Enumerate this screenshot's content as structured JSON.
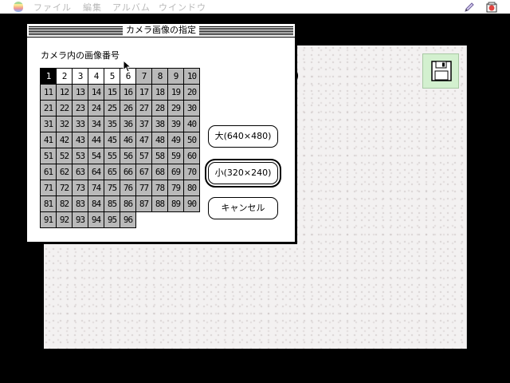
{
  "menubar": {
    "items": [
      "ファイル",
      "編集",
      "アルバム",
      "ウインドウ"
    ],
    "right_icons": [
      "pencil-icon",
      "application-icon"
    ]
  },
  "document_window": {
    "toolbar_icon": "floppy-disk-icon"
  },
  "dialog": {
    "title": "カメラ画像の指定",
    "grid_label": "カメラ内の画像番号",
    "selected_photo": 1,
    "photo_count": 96,
    "unshaded_numbers": [
      2,
      3,
      4,
      5,
      6
    ],
    "photos": [
      "1",
      "2",
      "3",
      "4",
      "5",
      "6",
      "7",
      "8",
      "9",
      "10",
      "11",
      "12",
      "13",
      "14",
      "15",
      "16",
      "17",
      "18",
      "19",
      "20",
      "21",
      "22",
      "23",
      "24",
      "25",
      "26",
      "27",
      "28",
      "29",
      "30",
      "31",
      "32",
      "33",
      "34",
      "35",
      "36",
      "37",
      "38",
      "39",
      "40",
      "41",
      "42",
      "43",
      "44",
      "45",
      "46",
      "47",
      "48",
      "49",
      "50",
      "51",
      "52",
      "53",
      "54",
      "55",
      "56",
      "57",
      "58",
      "59",
      "60",
      "61",
      "62",
      "63",
      "64",
      "65",
      "66",
      "67",
      "68",
      "69",
      "70",
      "71",
      "72",
      "73",
      "74",
      "75",
      "76",
      "77",
      "78",
      "79",
      "80",
      "81",
      "82",
      "83",
      "84",
      "85",
      "86",
      "87",
      "88",
      "89",
      "90",
      "91",
      "92",
      "93",
      "94",
      "95",
      "96"
    ],
    "buttons": {
      "large": "大(640×480)",
      "small": "小(320×240)",
      "cancel": "キャンセル"
    },
    "default_button": "small"
  },
  "colors": {
    "desktop": "#000000",
    "document_bg": "#f3f1f1",
    "disk_button_bg": "#d3f0cf",
    "cell_shaded": "#c9c9c9",
    "cell_selected": "#000000"
  }
}
